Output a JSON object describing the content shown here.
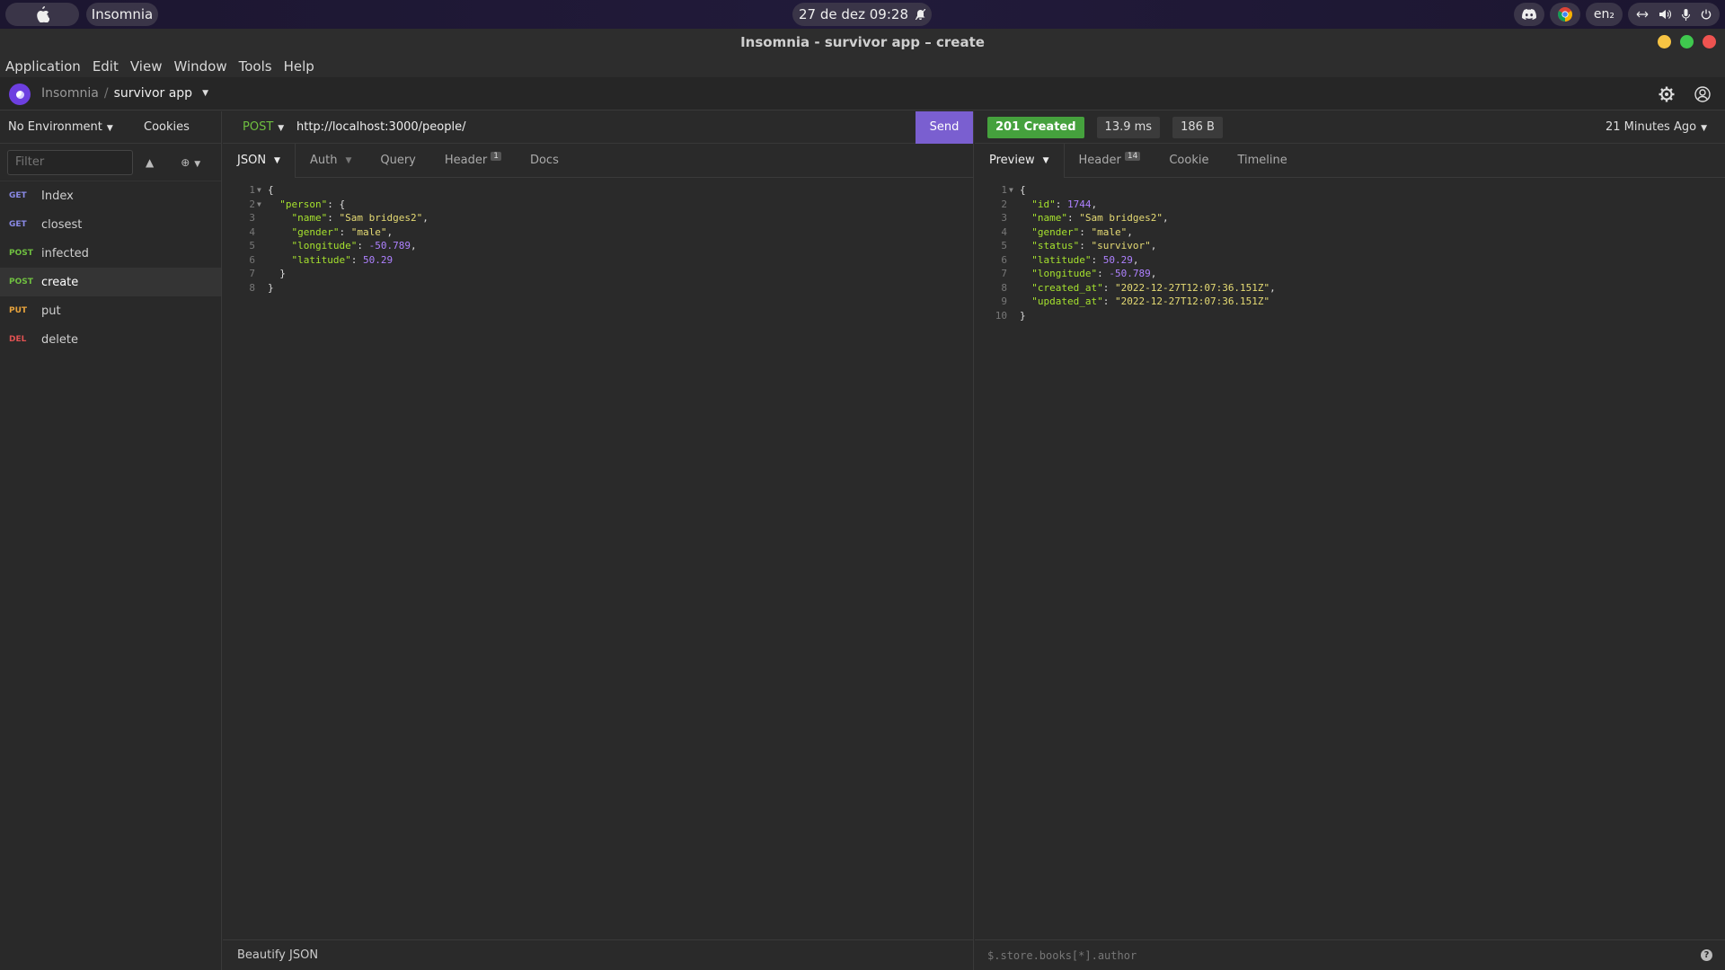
{
  "os": {
    "app_name": "Insomnia",
    "clock": "27 de dez  09:28",
    "keyboard": "en₂"
  },
  "window": {
    "title": "Insomnia - survivor app – create"
  },
  "menu": [
    "Application",
    "Edit",
    "View",
    "Window",
    "Tools",
    "Help"
  ],
  "breadcrumb": {
    "root": "Insomnia",
    "separator": "/",
    "project": "survivor app"
  },
  "sidebar": {
    "environment": "No Environment",
    "cookies": "Cookies",
    "filter_placeholder": "Filter",
    "requests": [
      {
        "method": "GET",
        "name": "Index",
        "color": "#8a8ae6"
      },
      {
        "method": "GET",
        "name": "closest",
        "color": "#8a8ae6"
      },
      {
        "method": "POST",
        "name": "infected",
        "color": "#6fbf40"
      },
      {
        "method": "POST",
        "name": "create",
        "color": "#6fbf40"
      },
      {
        "method": "PUT",
        "name": "put",
        "color": "#e8a33c"
      },
      {
        "method": "DEL",
        "name": "delete",
        "color": "#e05252"
      }
    ]
  },
  "request": {
    "method": "POST",
    "url": "http://localhost:3000/people/",
    "send_label": "Send",
    "tabs": [
      {
        "label": "JSON",
        "badge": ""
      },
      {
        "label": "Auth",
        "badge": ""
      },
      {
        "label": "Query",
        "badge": ""
      },
      {
        "label": "Header",
        "badge": "1"
      },
      {
        "label": "Docs",
        "badge": ""
      }
    ],
    "footer": "Beautify JSON"
  },
  "response": {
    "status": "201 Created",
    "time": "13.9 ms",
    "size": "186 B",
    "ago": "21 Minutes Ago",
    "tabs": [
      {
        "label": "Preview",
        "badge": ""
      },
      {
        "label": "Header",
        "badge": "14"
      },
      {
        "label": "Cookie",
        "badge": ""
      },
      {
        "label": "Timeline",
        "badge": ""
      }
    ],
    "filter_placeholder": "$.store.books[*].author"
  },
  "request_body": [
    {
      "n": "1",
      "fold": true,
      "indent": "",
      "parts": [
        [
          "pun",
          "{"
        ]
      ]
    },
    {
      "n": "2",
      "fold": true,
      "indent": "  ",
      "parts": [
        [
          "key",
          "\"person\""
        ],
        [
          "pun",
          ": {"
        ]
      ]
    },
    {
      "n": "3",
      "fold": false,
      "indent": "    ",
      "parts": [
        [
          "key",
          "\"name\""
        ],
        [
          "pun",
          ": "
        ],
        [
          "str",
          "\"Sam bridges2\""
        ],
        [
          "pun",
          ","
        ]
      ]
    },
    {
      "n": "4",
      "fold": false,
      "indent": "    ",
      "parts": [
        [
          "key",
          "\"gender\""
        ],
        [
          "pun",
          ": "
        ],
        [
          "str",
          "\"male\""
        ],
        [
          "pun",
          ","
        ]
      ]
    },
    {
      "n": "5",
      "fold": false,
      "indent": "    ",
      "parts": [
        [
          "key",
          "\"longitude\""
        ],
        [
          "pun",
          ": "
        ],
        [
          "num",
          "-50.789"
        ],
        [
          "pun",
          ","
        ]
      ]
    },
    {
      "n": "6",
      "fold": false,
      "indent": "    ",
      "parts": [
        [
          "key",
          "\"latitude\""
        ],
        [
          "pun",
          ": "
        ],
        [
          "num",
          "50.29"
        ]
      ]
    },
    {
      "n": "7",
      "fold": false,
      "indent": "  ",
      "parts": [
        [
          "pun",
          "}"
        ]
      ]
    },
    {
      "n": "8",
      "fold": false,
      "indent": "",
      "parts": [
        [
          "pun",
          "}"
        ]
      ]
    }
  ],
  "response_body": [
    {
      "n": "1",
      "fold": true,
      "indent": "",
      "parts": [
        [
          "pun",
          "{"
        ]
      ]
    },
    {
      "n": "2",
      "fold": false,
      "indent": "  ",
      "parts": [
        [
          "key",
          "\"id\""
        ],
        [
          "pun",
          ": "
        ],
        [
          "num",
          "1744"
        ],
        [
          "pun",
          ","
        ]
      ]
    },
    {
      "n": "3",
      "fold": false,
      "indent": "  ",
      "parts": [
        [
          "key",
          "\"name\""
        ],
        [
          "pun",
          ": "
        ],
        [
          "str",
          "\"Sam bridges2\""
        ],
        [
          "pun",
          ","
        ]
      ]
    },
    {
      "n": "4",
      "fold": false,
      "indent": "  ",
      "parts": [
        [
          "key",
          "\"gender\""
        ],
        [
          "pun",
          ": "
        ],
        [
          "str",
          "\"male\""
        ],
        [
          "pun",
          ","
        ]
      ]
    },
    {
      "n": "5",
      "fold": false,
      "indent": "  ",
      "parts": [
        [
          "key",
          "\"status\""
        ],
        [
          "pun",
          ": "
        ],
        [
          "str",
          "\"survivor\""
        ],
        [
          "pun",
          ","
        ]
      ]
    },
    {
      "n": "6",
      "fold": false,
      "indent": "  ",
      "parts": [
        [
          "key",
          "\"latitude\""
        ],
        [
          "pun",
          ": "
        ],
        [
          "num",
          "50.29"
        ],
        [
          "pun",
          ","
        ]
      ]
    },
    {
      "n": "7",
      "fold": false,
      "indent": "  ",
      "parts": [
        [
          "key",
          "\"longitude\""
        ],
        [
          "pun",
          ": "
        ],
        [
          "num",
          "-50.789"
        ],
        [
          "pun",
          ","
        ]
      ]
    },
    {
      "n": "8",
      "fold": false,
      "indent": "  ",
      "parts": [
        [
          "key",
          "\"created_at\""
        ],
        [
          "pun",
          ": "
        ],
        [
          "str",
          "\"2022-12-27T12:07:36.151Z\""
        ],
        [
          "pun",
          ","
        ]
      ]
    },
    {
      "n": "9",
      "fold": false,
      "indent": "  ",
      "parts": [
        [
          "key",
          "\"updated_at\""
        ],
        [
          "pun",
          ": "
        ],
        [
          "str",
          "\"2022-12-27T12:07:36.151Z\""
        ]
      ]
    },
    {
      "n": "10",
      "fold": false,
      "indent": "",
      "parts": [
        [
          "pun",
          "}"
        ]
      ]
    }
  ]
}
